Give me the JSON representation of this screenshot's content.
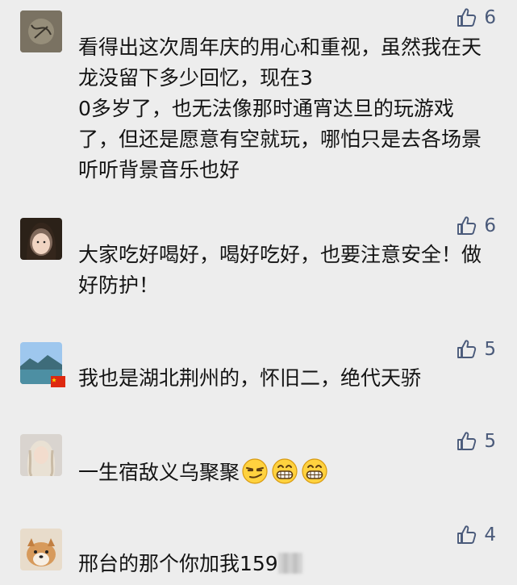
{
  "comments": [
    {
      "likes": "6",
      "text": "看得出这次周年庆的用心和重视，虽然我在天龙没留下多少回忆，现在3\n0多岁了，也无法像那时通宵达旦的玩游戏了，但还是愿意有空就玩，哪怕只是去各场景听听背景音乐也好"
    },
    {
      "likes": "6",
      "text": "大家吃好喝好，喝好吃好，也要注意安全！做好防护！"
    },
    {
      "likes": "5",
      "text": "我也是湖北荆州的，怀旧二，绝代天骄"
    },
    {
      "likes": "5",
      "text": "一生宿敌义乌聚聚"
    },
    {
      "likes": "4",
      "text": "邢台的那个你加我159"
    }
  ],
  "colors": {
    "background": "#ededed",
    "like_icon": "#4a5a7a",
    "text": "#141414"
  },
  "icons": {
    "like": "thumbs-up-icon",
    "flag": "china-flag-icon",
    "emoji_smirk": "smirk-emoji-icon",
    "emoji_grin": "grin-emoji-icon"
  }
}
